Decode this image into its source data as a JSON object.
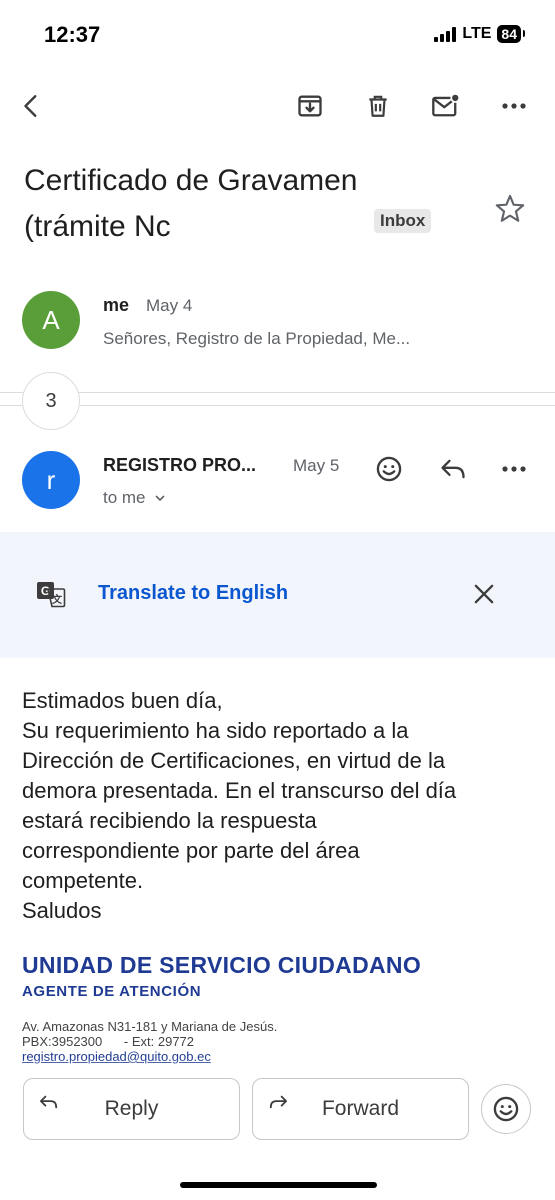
{
  "status_bar": {
    "time": "12:37",
    "network": "LTE",
    "battery": "84"
  },
  "toolbar": {
    "icons": [
      "back-arrow-icon",
      "archive-icon",
      "trash-icon",
      "mark-unread-icon",
      "more-vert-icon"
    ]
  },
  "thread": {
    "subject_line1": "Certificado de Gravamen",
    "subject_line2": "(trámite Nc",
    "label": "Inbox"
  },
  "messages": [
    {
      "avatar_letter": "A",
      "avatar_color": "#5a9e3a",
      "sender": "me",
      "date": "May 4",
      "snippet": "Señores, Registro de la Propiedad, Me..."
    },
    {
      "avatar_letter": "r",
      "avatar_color": "#1a73e8",
      "sender": "REGISTRO PRO...",
      "date": "May 5",
      "recipient": "to me"
    }
  ],
  "collapsed_count": "3",
  "translate": {
    "label": "Translate to English"
  },
  "body": {
    "lines": [
      "Estimados buen día,",
      "Su requerimiento ha sido reportado a la",
      "Dirección de Certificaciones, en virtud de la",
      "demora presentada. En el transcurso del día",
      "estará recibiendo la respuesta",
      "correspondiente por parte del área",
      "competente.",
      "Saludos"
    ]
  },
  "signature": {
    "title": "UNIDAD DE SERVICIO CIUDADANO",
    "subtitle": "AGENTE DE ATENCIÓN",
    "address": "Av. Amazonas N31-181 y Mariana de Jesús.",
    "phone": "PBX:3952300",
    "ext": "- Ext: 29772",
    "email": "registro.propiedad@quito.gob.ec"
  },
  "actions": {
    "reply": "Reply",
    "forward": "Forward"
  },
  "colors": {
    "accent": "#0b57d0",
    "signature": "#1f3a93"
  }
}
